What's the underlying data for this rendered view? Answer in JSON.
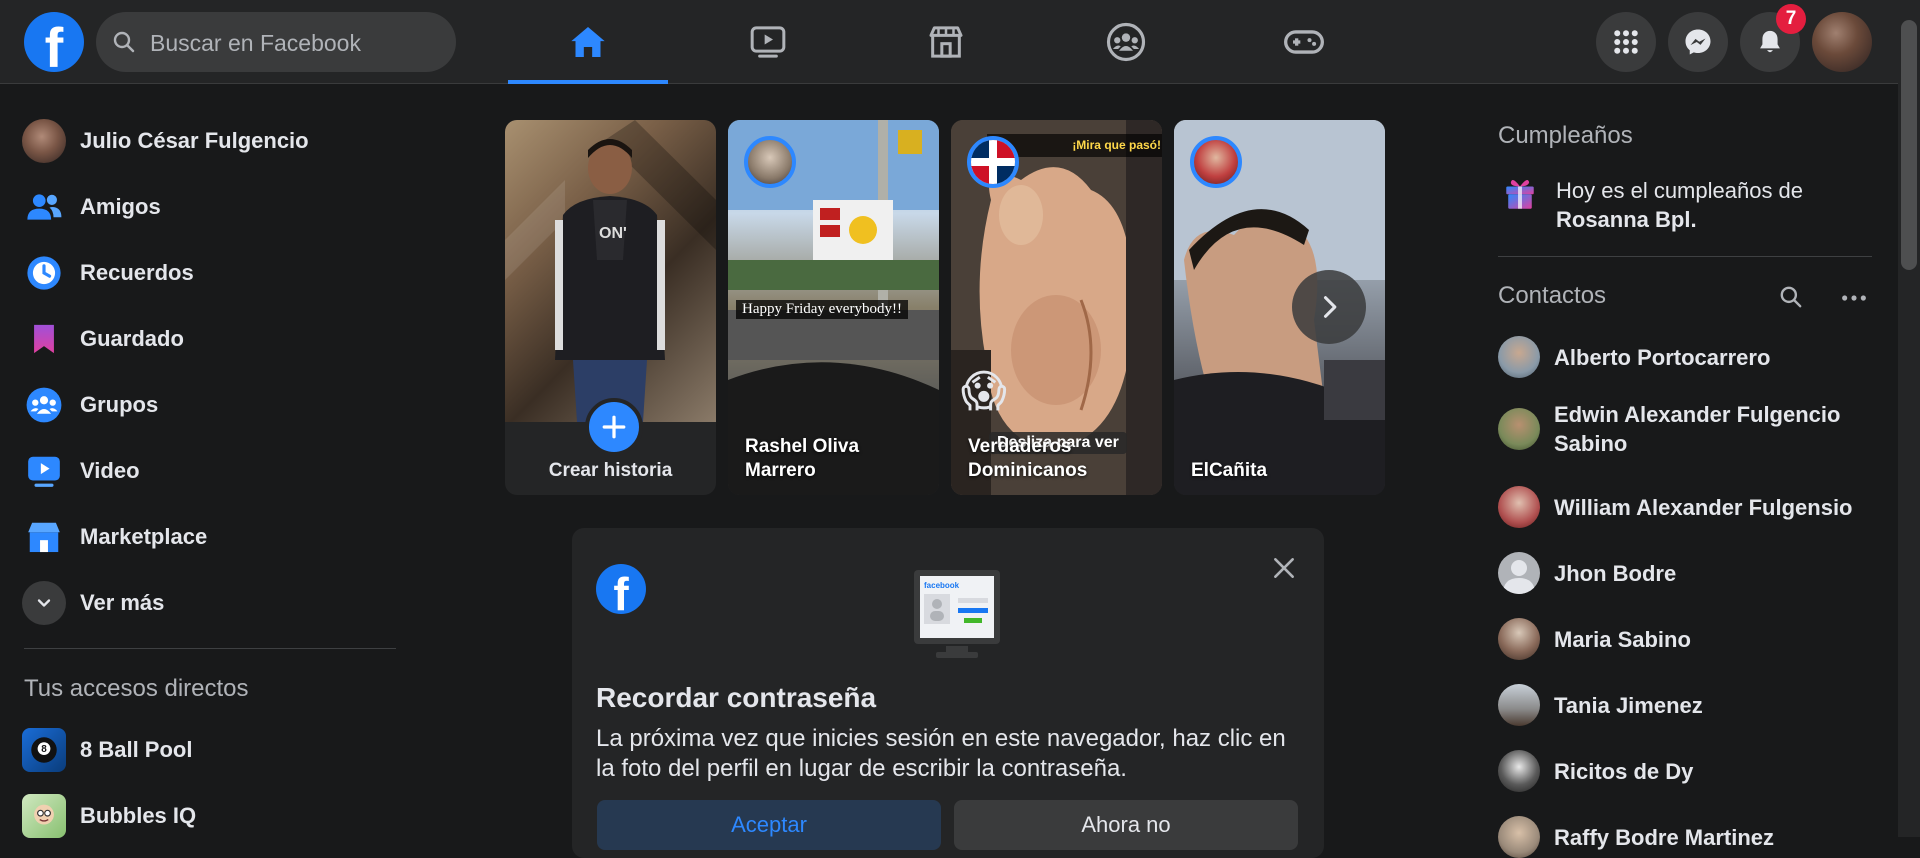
{
  "header": {
    "logo_letter": "f",
    "search_placeholder": "Buscar en Facebook",
    "nav_icons": [
      "home-icon",
      "watch-icon",
      "marketplace-icon",
      "groups-icon",
      "gaming-icon"
    ],
    "notification_count": "7"
  },
  "sidebar": {
    "items": [
      {
        "label": "Julio César Fulgencio",
        "icon": "profile-avatar"
      },
      {
        "label": "Amigos",
        "icon": "friends-icon"
      },
      {
        "label": "Recuerdos",
        "icon": "memories-icon"
      },
      {
        "label": "Guardado",
        "icon": "saved-icon"
      },
      {
        "label": "Grupos",
        "icon": "groups-icon"
      },
      {
        "label": "Video",
        "icon": "video-icon"
      },
      {
        "label": "Marketplace",
        "icon": "marketplace-icon"
      },
      {
        "label": "Ver más",
        "icon": "chevron-down-icon"
      }
    ],
    "shortcuts_title": "Tus accesos directos",
    "shortcuts": [
      {
        "label": "8 Ball Pool",
        "icon": "8-ball-pool-icon"
      },
      {
        "label": "Bubbles IQ",
        "icon": "bubbles-iq-icon"
      }
    ]
  },
  "stories": {
    "create_label": "Crear historia",
    "items": [
      {
        "name": "Rashel Oliva Marrero",
        "caption": "Happy Friday everybody!!"
      },
      {
        "name": "Verdaderos Dominicanos",
        "caption_top": "¡Mira que pasó!",
        "caption_mid": "Desliza para ver"
      },
      {
        "name": "ElCañita"
      }
    ]
  },
  "password_card": {
    "title": "Recordar contraseña",
    "body": "La próxima vez que inicies sesión en este navegador, haz clic en la foto del perfil en lugar de escribir la contraseña.",
    "accept_label": "Aceptar",
    "decline_label": "Ahora no",
    "illustration_brand": "facebook"
  },
  "birthdays": {
    "title": "Cumpleaños",
    "text_prefix": "Hoy es el cumpleaños de",
    "person": "Rosanna Bpl."
  },
  "contacts": {
    "title": "Contactos",
    "items": [
      {
        "name": "Alberto Portocarrero",
        "color": "#8a9aa8"
      },
      {
        "name": "Edwin Alexander Fulgencio Sabino",
        "color": "#7a8a5a"
      },
      {
        "name": "William Alexander Fulgensio",
        "color": "#b05050"
      },
      {
        "name": "Jhon Bodre",
        "color": "#b0b3b8"
      },
      {
        "name": "Maria Sabino",
        "color": "#8a6a5a"
      },
      {
        "name": "Tania Jimenez",
        "color": "#8a8a8a"
      },
      {
        "name": "Ricitos de Dy",
        "color": "#5a5a5a"
      },
      {
        "name": "Raffy Bodre Martinez",
        "color": "#9a8a7a"
      }
    ]
  },
  "colors": {
    "accent": "#2d88ff",
    "brand": "#1877f2",
    "background": "#18191a",
    "surface": "#242526",
    "badge": "#e41e3f"
  }
}
